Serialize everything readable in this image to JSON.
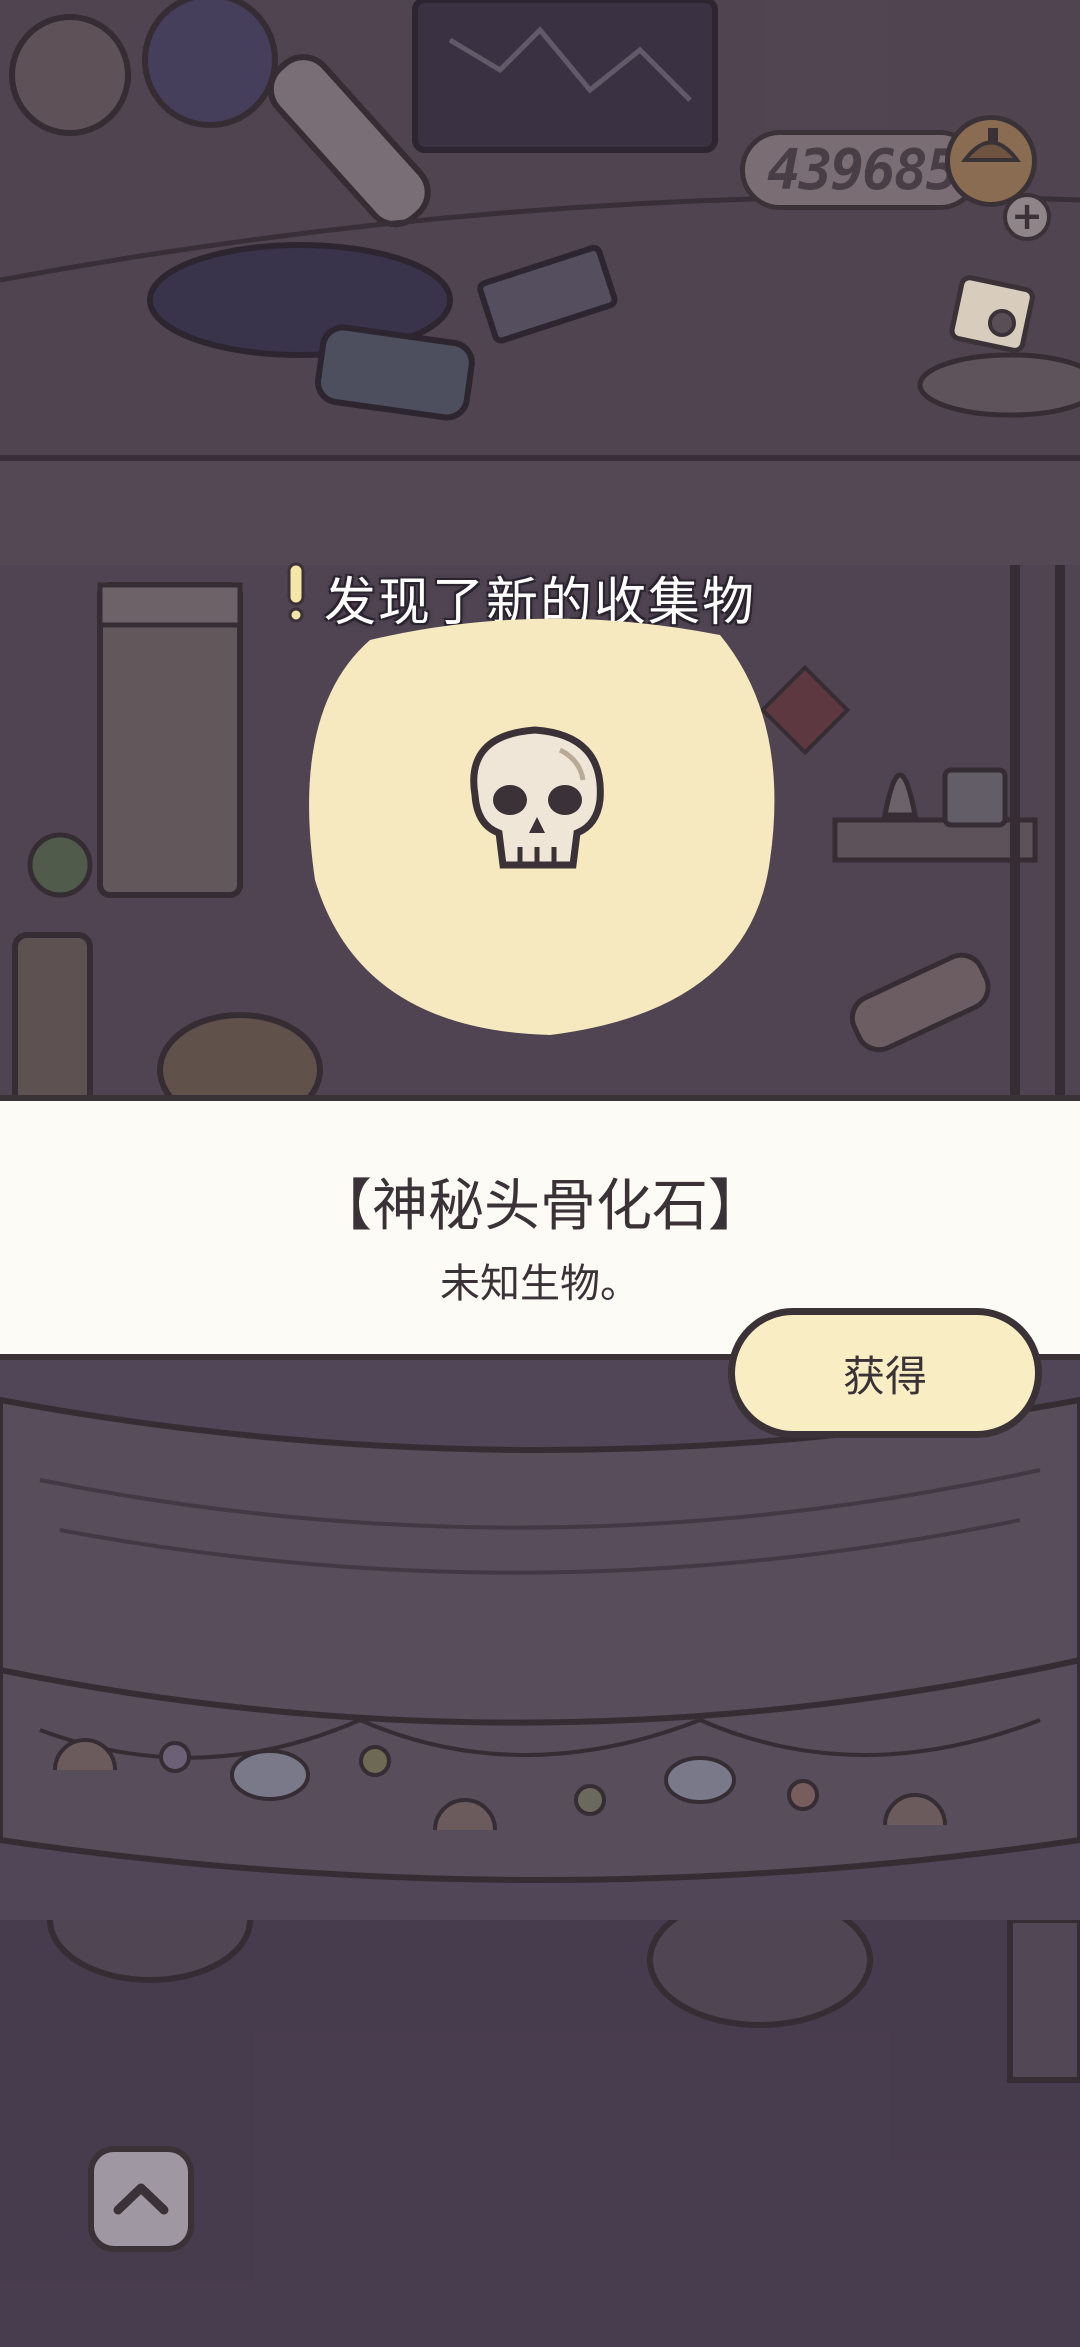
{
  "currency": {
    "coins": "439685",
    "coin_icon": "acorn-coin-icon",
    "add_icon": "plus-icon"
  },
  "notification": {
    "title": "发现了新的收集物",
    "mark_icon": "exclamation-icon"
  },
  "item": {
    "icon": "skull-icon",
    "name": "【神秘头骨化石】",
    "description": "未知生物。"
  },
  "actions": {
    "obtain_label": "获得",
    "expand_icon": "chevron-up-icon"
  },
  "colors": {
    "panel_bg": "#fdfbf6",
    "blob": "#f6e9bf",
    "button": "#f9eec3",
    "outline": "#3b3238",
    "scene_dim": "#52475a"
  }
}
